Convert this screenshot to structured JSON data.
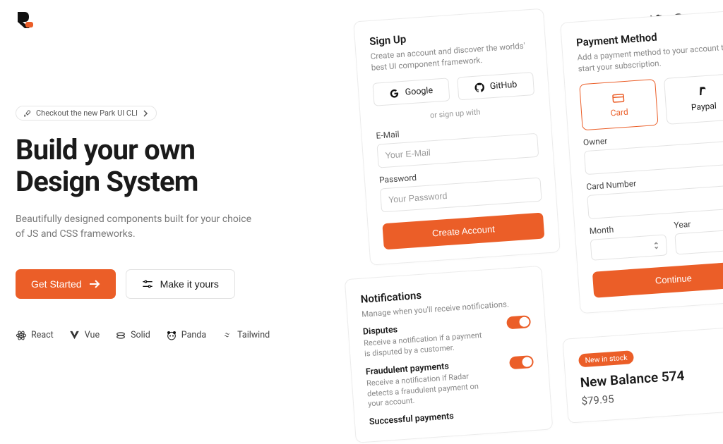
{
  "colors": {
    "accent": "#eb5e28"
  },
  "nav": {
    "tw": "twitter-icon",
    "gh": "github-icon",
    "mode": "sun-icon"
  },
  "hero": {
    "badge": "Checkout the new Park UI CLI",
    "title_line1": "Build your own",
    "title_line2": "Design System",
    "subtitle": "Beautifully designed components built for your choice of JS and CSS frameworks.",
    "cta_primary": "Get Started",
    "cta_secondary": "Make it yours"
  },
  "frameworks": [
    "React",
    "Vue",
    "Solid",
    "Panda",
    "Tailwind"
  ],
  "signup": {
    "title": "Sign Up",
    "subtitle": "Create an account and discover the worlds' best UI component framework.",
    "google": "Google",
    "github": "GitHub",
    "separator": "or sign up with",
    "email_label": "E-Mail",
    "email_ph": "Your E-Mail",
    "pw_label": "Password",
    "pw_ph": "Your Password",
    "submit": "Create Account"
  },
  "payment": {
    "title": "Payment Method",
    "subtitle": "Add a payment method to your account to start your subscription.",
    "opt_card": "Card",
    "opt_paypal": "Paypal",
    "owner_label": "Owner",
    "card_label": "Card Number",
    "month_label": "Month",
    "year_label": "Year",
    "submit": "Continue"
  },
  "notifications": {
    "title": "Notifications",
    "subtitle": "Manage when you'll receive notifications.",
    "items": [
      {
        "title": "Disputes",
        "desc": "Receive a notification if a payment is disputed by a customer.",
        "on": true
      },
      {
        "title": "Fraudulent payments",
        "desc": "Receive a notification if Radar detects a fraudulent payment on your account.",
        "on": true
      },
      {
        "title": "Successful payments",
        "desc": "",
        "on": true
      }
    ]
  },
  "product": {
    "badge": "New in stock",
    "name": "New Balance 574",
    "price": "$79.95"
  }
}
